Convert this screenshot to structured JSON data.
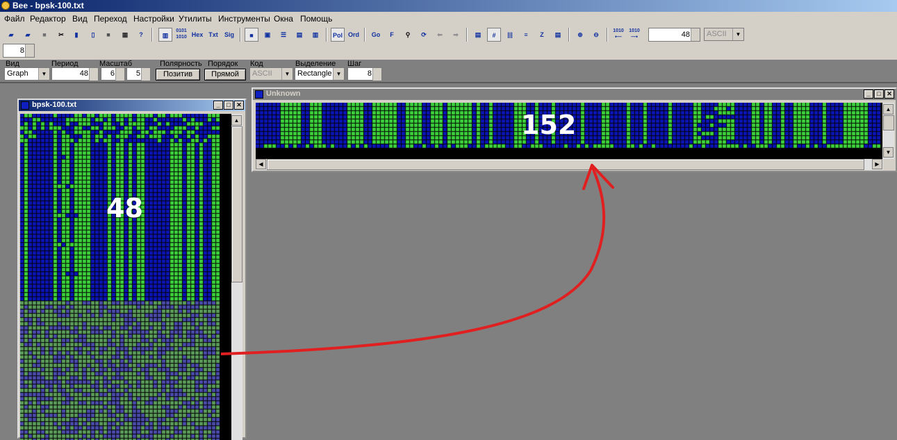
{
  "app": {
    "title": "Bee - bpsk-100.txt"
  },
  "menu": [
    "Файл",
    "Редактор",
    "Вид",
    "Переход",
    "Настройки",
    "Утилиты",
    "Инструменты",
    "Окна",
    "Помощь"
  ],
  "toolbar": {
    "mode_labels": {
      "hex": "Hex",
      "txt": "Txt",
      "sig": "Sig",
      "pol": "Pol",
      "ord": "Ord",
      "go": "Go",
      "f": "F"
    },
    "period_value": "48",
    "code_value": "ASCII",
    "row2_value": "8"
  },
  "params": {
    "view_label": "Вид",
    "view_value": "Graph",
    "period_label": "Период",
    "period_value": "48",
    "scale_label": "Масштаб",
    "scale_x": "6",
    "scale_y": "5",
    "polarity_label": "Полярность",
    "polarity_value": "Позитив",
    "order_label": "Порядок",
    "order_value": "Прямой",
    "code_label": "Код",
    "code_value": "ASCII",
    "selection_label": "Выделение",
    "selection_value": "Rectangle",
    "step_label": "Шаг",
    "step_value": "8"
  },
  "windows": {
    "left": {
      "title": "bpsk-100.txt",
      "annotation": "48"
    },
    "right": {
      "title": "Unknown",
      "annotation": "152"
    }
  },
  "colors": {
    "bit_one": "#3cd13c",
    "bit_zero": "#0a14b4",
    "bit_one_dim": "#5a9a5a",
    "bit_zero_dim": "#4a4aa8",
    "arrow": "#e02020"
  }
}
